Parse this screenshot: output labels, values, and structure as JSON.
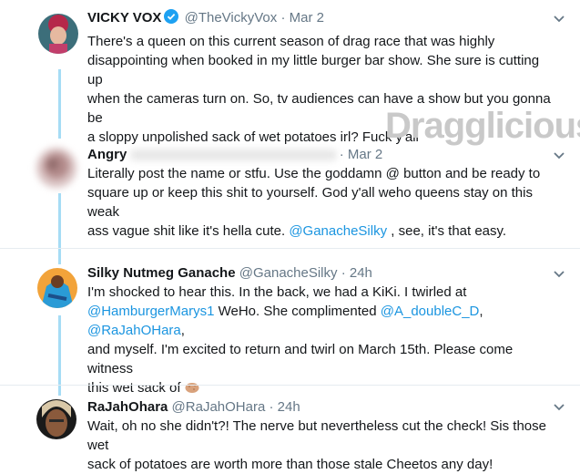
{
  "watermark": "Dragglicious",
  "tweets": [
    {
      "name": "VICKY VOX",
      "handle": "@TheVickyVox",
      "sep": "·",
      "time": "Mar 2",
      "lines": [
        "There's a queen on this current season of drag race that was highly",
        "disappointing when booked in my little burger bar show. She sure is cutting up",
        "when the cameras turn on. So, tv audiences can have a show but you gonna be",
        "a sloppy unpolished sack of wet potatoes irl? Fuck y'all"
      ]
    },
    {
      "name": "Angry",
      "sep": "·",
      "time": "Mar 2",
      "lines": [
        "Literally post the name or stfu. Use the goddamn @ button and be ready to",
        "square up or keep this shit to yourself. God y'all weho queens stay on this weak"
      ],
      "line3_pre": "ass vague shit like it's hella cute. ",
      "line3_mention": "@GanacheSilky",
      "line3_post": " , see, it's that easy."
    },
    {
      "name": "Silky Nutmeg Ganache",
      "handle": "@GanacheSilky",
      "sep": "·",
      "time": "24h",
      "line1": "I'm shocked to hear this. In the back, we had a KiKi. I twirled at",
      "line2_mention": "@HamburgerMarys1",
      "line2_post": " WeHo. She complimented ",
      "line2_mention2": "@A_doubleC_D",
      "line2_comma": ", ",
      "line2_mention3": "@RaJahOHara",
      "line2_end": ",",
      "line3": "and myself. I'm excited to return and twirl on March 15th. Please come witness",
      "line4": "this wet sack of "
    },
    {
      "name": "RaJahOhara",
      "handle": "@RaJahOHara",
      "sep": "·",
      "time": "24h",
      "line1": "Wait, oh no she didn't?! The nerve but nevertheless cut the check! Sis those wet",
      "line2": "sack of potatoes are worth more than those stale Cheetos any day!"
    }
  ]
}
